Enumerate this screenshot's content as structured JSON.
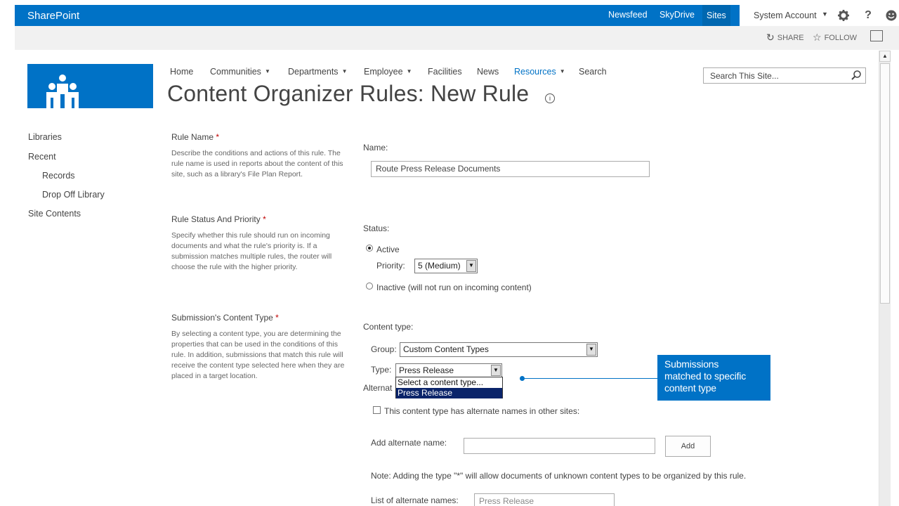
{
  "suite_bar": {
    "brand": "SharePoint",
    "links": [
      "Newsfeed",
      "SkyDrive",
      "Sites"
    ],
    "account": "System Account",
    "help_icon": "question-icon",
    "settings_icon": "gear-icon",
    "avatar_icon": "smiley-icon",
    "color": "#0072c6"
  },
  "ribbon": {
    "share": "SHARE",
    "follow": "FOLLOW"
  },
  "top_nav": {
    "items": [
      {
        "label": "Home"
      },
      {
        "label": "Communities"
      },
      {
        "label": "Departments"
      },
      {
        "label": "Employee"
      },
      {
        "label": "Facilities"
      },
      {
        "label": "News"
      },
      {
        "label": "Resources"
      },
      {
        "label": "Search"
      }
    ],
    "selected": "Resources"
  },
  "page_title": "Content Organizer Rules: New Rule",
  "search": {
    "placeholder": "Search This Site..."
  },
  "quick_launch": {
    "items": [
      "Libraries",
      "Recent",
      "Records",
      "Drop Off Library",
      "Site Contents"
    ]
  },
  "sections": {
    "rule_name": {
      "title": "Rule Name",
      "required": "*",
      "description": "Describe the conditions and actions of this rule. The rule name is used in reports about the content of this site, such as a library's File Plan Report.",
      "field_label": "Name:",
      "value": "Route Press Release Documents"
    },
    "status": {
      "title": "Rule Status And Priority",
      "required": "*",
      "description": "Specify whether this rule should run on incoming documents and what the rule's priority is. If a submission matches multiple rules, the router will choose the rule with the higher priority.",
      "field_label": "Status:",
      "active_label": "Active",
      "priority_label": "Priority:",
      "priority_value": "5 (Medium)",
      "inactive_label": "Inactive (will not run on incoming content)"
    },
    "content_type": {
      "title": "Submission's Content Type",
      "required": "*",
      "description": "By selecting a content type, you are determining the properties that can be used in the conditions of this rule. In addition, submissions that match this rule will receive the content type selected here when they are placed in a target location.",
      "field_label": "Content type:",
      "group_label": "Group:",
      "group_value": "Custom Content Types",
      "type_label": "Type:",
      "type_value": "Press Release",
      "type_options": [
        "Select a content type...",
        "Press Release"
      ],
      "alternate_label": "Alternat",
      "alternate_checkbox": "This content type has alternate names in other sites:",
      "add_alternate_label": "Add alternate name:",
      "add_button": "Add",
      "note": "Note: Adding the type \"*\" will allow documents of unknown content types to be organized by this rule.",
      "list_label": "List of alternate names:",
      "list_value": "Press Release"
    }
  },
  "callout": {
    "lines": [
      "Submissions",
      "matched to specific",
      "content type"
    ]
  }
}
